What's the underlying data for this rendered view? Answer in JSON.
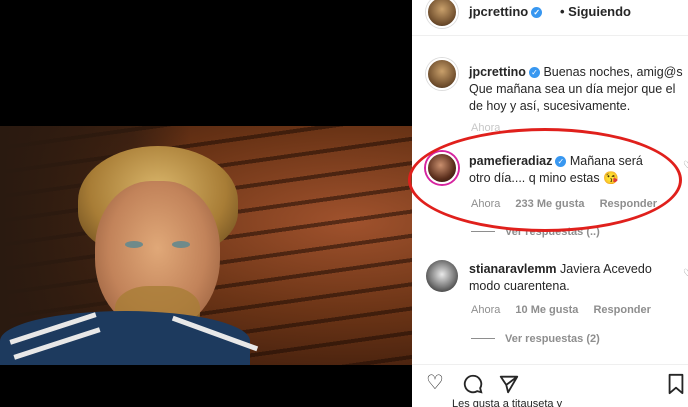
{
  "post": {
    "author": "jpcrettino",
    "follow_state": "• Siguiendo"
  },
  "caption": {
    "user": "jpcrettino",
    "line1": "Buenas noches, amig@s",
    "line2": "Que mañana sea un día mejor que el",
    "line3": "de hoy y así, sucesivamente.",
    "time": "Ahora"
  },
  "comments": [
    {
      "user": "pamefieradiaz",
      "line1": "Mañana será",
      "line2": "otro día.... q mino estas 😘",
      "time": "Ahora",
      "likes": "233 Me gusta",
      "reply": "Responder",
      "view_replies": "Ver respuestas (..)"
    },
    {
      "user": "stianaravlemm",
      "line1": "Javiera Acevedo",
      "line2": "modo cuarentena.",
      "time": "Ahora",
      "likes": "10 Me gusta",
      "reply": "Responder",
      "view_replies": "Ver respuestas (2)"
    }
  ],
  "actions": {
    "like_icon": "heart-icon",
    "comment_icon": "comment-icon",
    "share_icon": "paper-plane-icon",
    "save_icon": "bookmark-icon"
  },
  "likes_summary": "Les gusta a titauseta y",
  "colors": {
    "annotation_circle": "#e0201c",
    "verified": "#3897f0",
    "muted_text": "#8e8e8e"
  }
}
